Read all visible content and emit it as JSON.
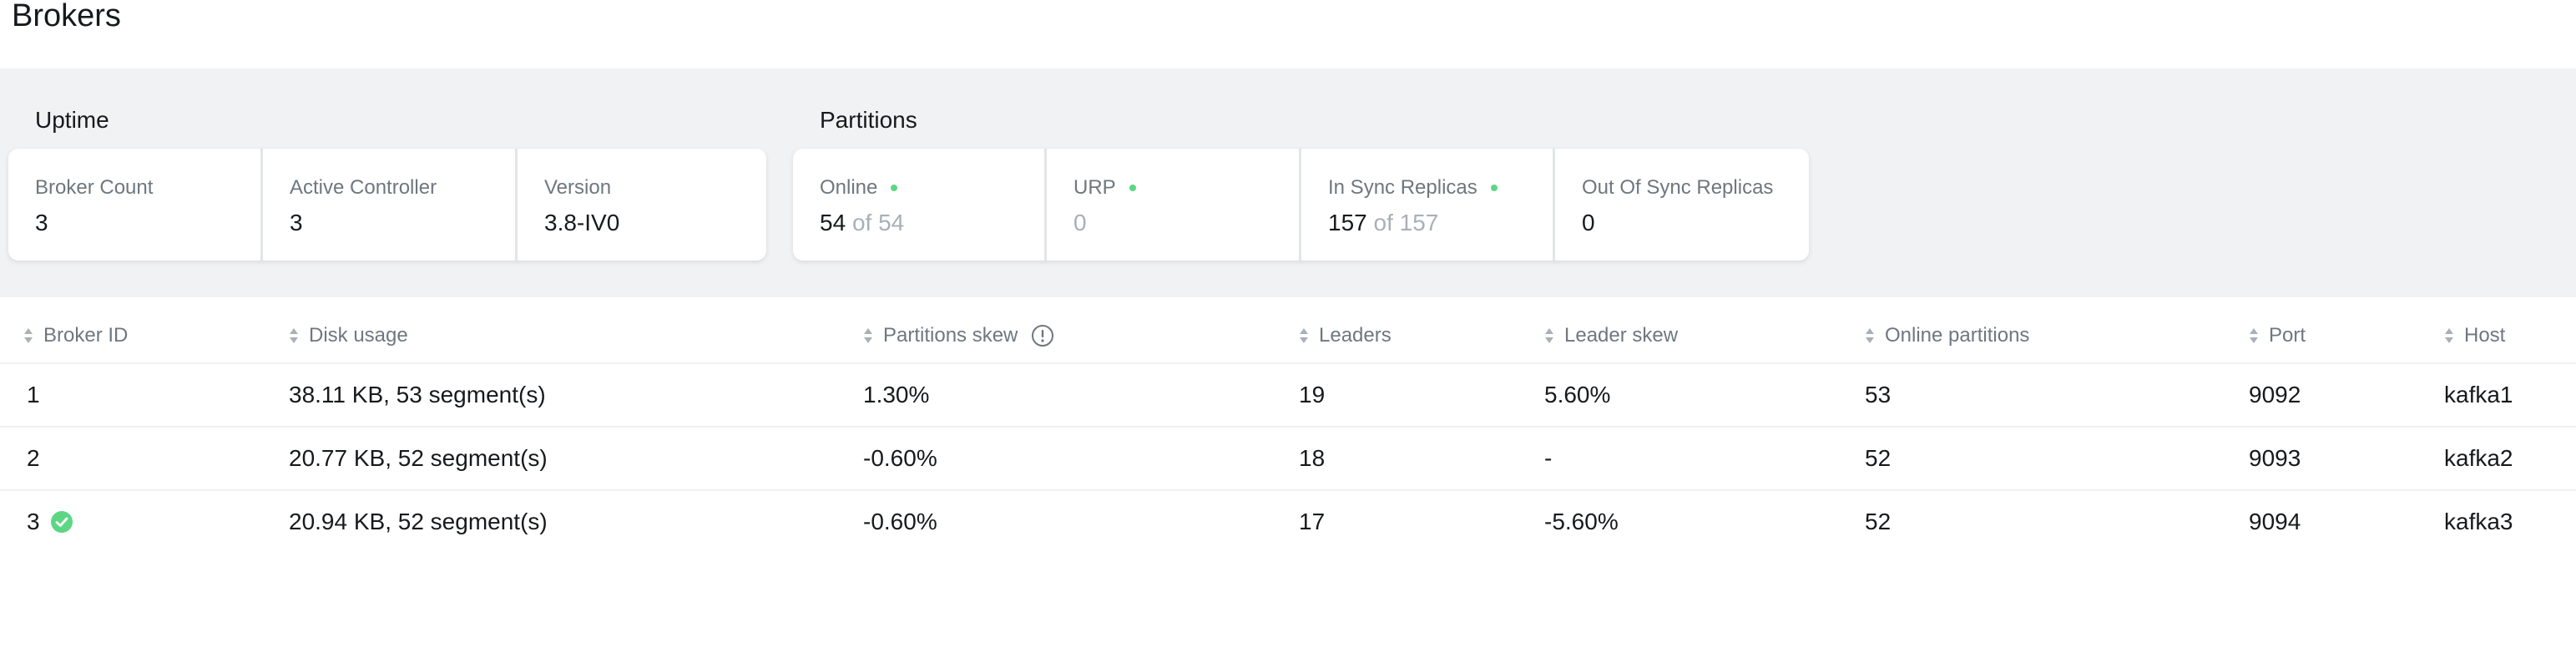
{
  "page": {
    "title": "Brokers"
  },
  "uptime": {
    "title": "Uptime",
    "metrics": [
      {
        "label": "Broker Count",
        "value": "3"
      },
      {
        "label": "Active Controller",
        "value": "3"
      },
      {
        "label": "Version",
        "value": "3.8-IV0"
      }
    ]
  },
  "partitions": {
    "title": "Partitions",
    "online": {
      "label": "Online",
      "value": "54",
      "of_text": "of 54"
    },
    "urp": {
      "label": "URP",
      "value": "0"
    },
    "in_sync": {
      "label": "In Sync Replicas",
      "value": "157",
      "of_text": "of 157"
    },
    "out_of_sync": {
      "label": "Out Of Sync Replicas",
      "value": "0"
    }
  },
  "colors": {
    "status_ok": "#5cd685",
    "band_background": "#f1f2f3",
    "muted_text": "#a8b0b8"
  },
  "table": {
    "headers": {
      "broker_id": "Broker ID",
      "disk_usage": "Disk usage",
      "partitions_skew": "Partitions skew",
      "leaders": "Leaders",
      "leader_skew": "Leader skew",
      "online_partitions": "Online partitions",
      "port": "Port",
      "host": "Host"
    },
    "header_icons": {
      "sort": "sort-icon",
      "info": "info-icon"
    },
    "rows": [
      {
        "broker_id": "1",
        "disk_usage": "38.11 KB, 53 segment(s)",
        "partitions_skew": "1.30%",
        "leaders": "19",
        "leader_skew": "5.60%",
        "online_partitions": "53",
        "port": "9092",
        "host": "kafka1"
      },
      {
        "broker_id": "2",
        "disk_usage": "20.77 KB, 52 segment(s)",
        "partitions_skew": "-0.60%",
        "leaders": "18",
        "leader_skew": "-",
        "online_partitions": "52",
        "port": "9093",
        "host": "kafka2"
      },
      {
        "broker_id": "3",
        "is_controller_icon": "check-circle-icon",
        "disk_usage": "20.94 KB, 52 segment(s)",
        "partitions_skew": "-0.60%",
        "leaders": "17",
        "leader_skew": "-5.60%",
        "online_partitions": "52",
        "port": "9094",
        "host": "kafka3"
      }
    ]
  }
}
